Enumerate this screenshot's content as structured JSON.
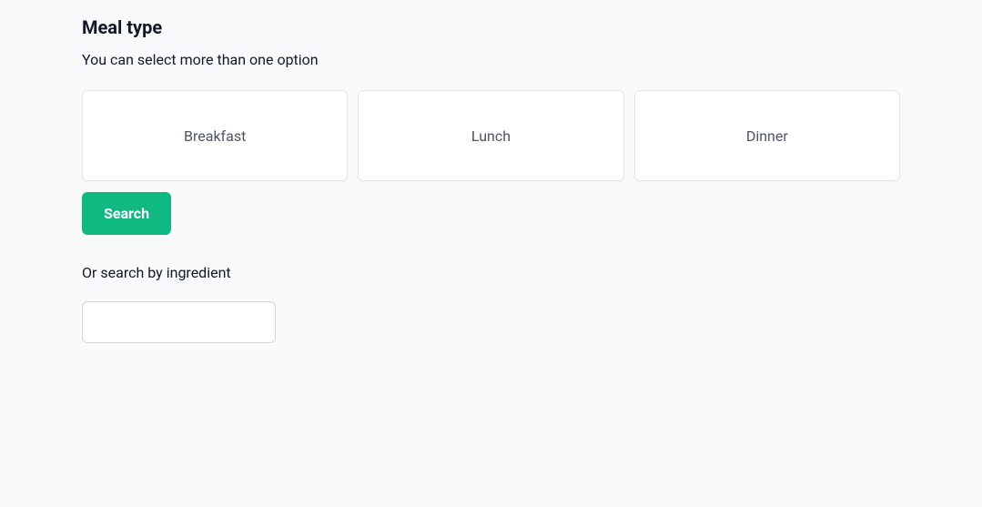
{
  "mealType": {
    "title": "Meal type",
    "subtitle": "You can select more than one option",
    "options": [
      {
        "label": "Breakfast"
      },
      {
        "label": "Lunch"
      },
      {
        "label": "Dinner"
      }
    ],
    "searchButton": "Search",
    "altLabel": "Or search by ingredient",
    "ingredientInput": {
      "value": "",
      "placeholder": ""
    }
  }
}
